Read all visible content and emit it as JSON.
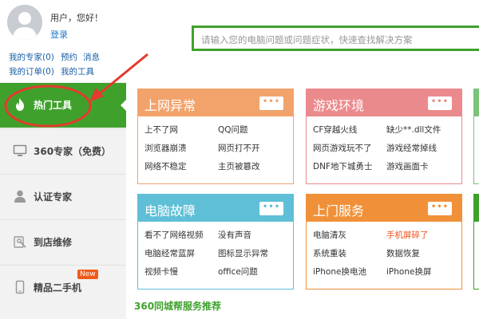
{
  "user": {
    "greeting": "用户，您好！",
    "login": "登录",
    "links": [
      "我的专家(0)",
      "预约",
      "消息",
      "我的订单(0)",
      "我的工具"
    ]
  },
  "sidebar": {
    "items": [
      {
        "label": "热门工具",
        "icon": "fire-icon",
        "active": true
      },
      {
        "label": "360专家（免费）",
        "icon": "monitor-icon"
      },
      {
        "label": "认证专家",
        "icon": "person-icon"
      },
      {
        "label": "到店维修",
        "icon": "repair-icon"
      },
      {
        "label": "精品二手机",
        "icon": "phone-icon",
        "badge": "New"
      }
    ]
  },
  "search": {
    "placeholder": "请输入您的电脑问题或问题症状，快速查找解决方案"
  },
  "cards": [
    {
      "title": "上网异常",
      "color": "#f2a36c",
      "links": [
        "上不了网",
        "QQ问题",
        "浏览器崩溃",
        "网页打不开",
        "网络不稳定",
        "主页被篡改"
      ]
    },
    {
      "title": "游戏环境",
      "color": "#eb8a8c",
      "links": [
        "CF穿越火线",
        "缺少**.dll文件",
        "网页游戏玩不了",
        "游戏经常掉线",
        "DNF地下城勇士",
        "游戏画面卡"
      ]
    },
    {
      "title": "电脑故障",
      "color": "#5fbfd6",
      "links": [
        "看不了网络视频",
        "没有声音",
        "电脑经常蓝屏",
        "图标显示异常",
        "视频卡慢",
        "office问题"
      ]
    },
    {
      "title": "上门服务",
      "color": "#f0913a",
      "links": [
        "电脑清灰",
        "手机屏碎了",
        "系统重装",
        "数据恢复",
        "iPhone换电池",
        "iPhone换屏"
      ],
      "hot_link": "手机屏碎了"
    }
  ],
  "more_label": "•••",
  "recommend_title": "360同城帮服务推荐",
  "colors": {
    "brand_green": "#3fa12c",
    "annotation_red": "#e33b2e"
  }
}
